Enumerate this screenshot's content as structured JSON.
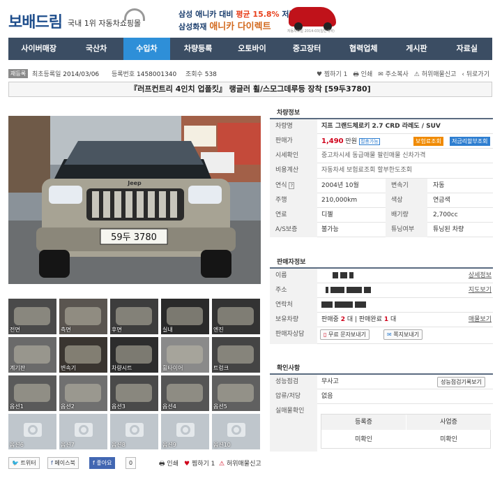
{
  "header": {
    "logo": "보배드림",
    "tagline": "국내 1위 자동차쇼핑몰",
    "ad_line1_a": "삼성 애니카 대비 ",
    "ad_line1_b": "평균 15.8%",
    "ad_line1_c": " 저렴한!",
    "ad_line2_a": "삼성화재 ",
    "ad_line2_b": "애니카 다이렉트",
    "ad_caption": "자동차보험 2014-03(일반계약)"
  },
  "nav": [
    {
      "label": "사이버매장",
      "w": 70
    },
    {
      "label": "국산차",
      "w": 62
    },
    {
      "label": "수입차",
      "w": 54,
      "active": true
    },
    {
      "label": "차량등록",
      "w": 64
    },
    {
      "label": "오토바이",
      "w": 60
    },
    {
      "label": "중고장터",
      "w": 66
    },
    {
      "label": "협력업체",
      "w": 64
    },
    {
      "label": "게시판",
      "w": 58
    },
    {
      "label": "자료실",
      "w": 58
    }
  ],
  "info": {
    "badge": "재등록",
    "first_reg_label": "최초등록일",
    "first_reg": "2014/03/06",
    "reg_no_label": "등록번호",
    "reg_no": "1458001340",
    "views_label": "조회수",
    "views": "538",
    "tools": [
      "♥ 찜하기 1",
      "🖶 인쇄",
      "✉ 주소복사",
      "⚠ 허위매물신고",
      "‹ 뒤로가기"
    ]
  },
  "title": "『러프컨트리 4인치 업폴킷』 랭글러 휠/스모그데루등 장착  [59두3780]",
  "photo": {
    "plate": "59두 3780",
    "brand": "Jeep"
  },
  "thumbs": [
    "전면",
    "측면",
    "후면",
    "실내",
    "엔진",
    "계기판",
    "변속기",
    "차량시트",
    "휠타이어",
    "트렁크",
    "옵션1",
    "옵션2",
    "옵션3",
    "옵션4",
    "옵션5",
    "옵션6",
    "옵션7",
    "옵션8",
    "옵션9",
    "옵션10"
  ],
  "vehicle": {
    "section": "차량정보",
    "name_label": "차량명",
    "name": "지프 그랜드체로키 2.7 CRD 라레도 / SUV",
    "price_label": "판매가",
    "price": "1,490",
    "price_unit": "만원",
    "price_badge": "절충가능",
    "btn_insurance": "보험료조회",
    "btn_loan": "저금리할부조회",
    "market_label": "시세확인",
    "market": "중고차시세   동급매물   팔린매물   신차가격",
    "cost_label": "비용계산",
    "cost": "자동차세   보험료조회   할부한도조회",
    "year_label": "연식",
    "year": "2004년 10월",
    "trans_label": "변속기",
    "trans": "자동",
    "km_label": "주행",
    "km": "210,000km",
    "color_label": "색상",
    "color": "연금색",
    "fuel_label": "연료",
    "fuel": "디젤",
    "cc_label": "배기량",
    "cc": "2,700cc",
    "as_label": "A/S보증",
    "as": "불가능",
    "tune_label": "튜닝여부",
    "tune": "튜닝된 차량"
  },
  "seller": {
    "section": "판매자정보",
    "name_label": "이름",
    "detail_link": "상세정보",
    "addr_label": "주소",
    "map_link": "지도보기",
    "contact_label": "연락처",
    "own_label": "보유차량",
    "own_a": "판매중 ",
    "own_a_n": "2",
    "own_a_u": " 대  |  판매완료 ",
    "own_b_n": "1",
    "own_b_u": " 대",
    "list_link": "매물보기",
    "consult_label": "판매자상담",
    "btn_sms": "무료 문자보내기",
    "btn_note": "쪽지보내기"
  },
  "confirm": {
    "section": "확인사항",
    "perf_label": "성능점검",
    "perf": "무사고",
    "perf_btn": "성능점검기록보기",
    "lien_label": "압류/저당",
    "lien": "없음",
    "real_label": "실매물확인",
    "h1": "등록증",
    "h2": "사업증",
    "v1": "미확인",
    "v2": "미확인"
  },
  "bottom": {
    "twitter": "트위터",
    "facebook": "페이스북",
    "like": "좋아요",
    "like_count": "0",
    "print": "인쇄",
    "fav": "찜하기 1",
    "report": "허위매물신고"
  }
}
